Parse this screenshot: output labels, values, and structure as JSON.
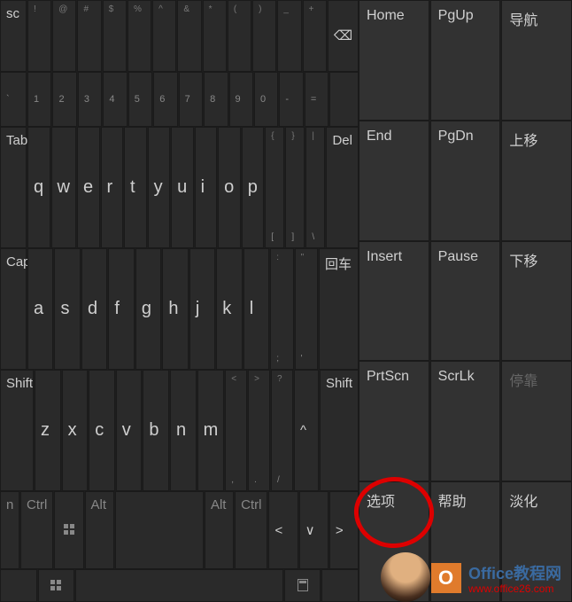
{
  "row0": {
    "esc": "sc",
    "syms": [
      "!",
      "@",
      "#",
      "$",
      "%",
      "^",
      "&",
      "*",
      "(",
      ")",
      "_",
      "+"
    ],
    "backspace": "⌫"
  },
  "row0b": {
    "nums": [
      "`",
      "1",
      "2",
      "3",
      "4",
      "5",
      "6",
      "7",
      "8",
      "9",
      "0",
      "-",
      "="
    ]
  },
  "row1": {
    "tab": "Tab",
    "keys": [
      "q",
      "w",
      "e",
      "r",
      "t",
      "y",
      "u",
      "i",
      "o",
      "p"
    ],
    "brackets": [
      "{",
      "}",
      "|"
    ],
    "del": "Del"
  },
  "row1b": {
    "syms": [
      "[",
      "]",
      "\\"
    ]
  },
  "row2": {
    "caps": "Caps",
    "keys": [
      "a",
      "s",
      "d",
      "f",
      "g",
      "h",
      "j",
      "k",
      "l"
    ],
    "colon": ":",
    "quote": "\"",
    "enter": "回车"
  },
  "row2b": {
    "syms": [
      ";",
      "'"
    ]
  },
  "row3": {
    "shift_l": "Shift",
    "keys": [
      "z",
      "x",
      "c",
      "v",
      "b",
      "n",
      "m"
    ],
    "syms_top": [
      "<",
      ">",
      "?"
    ],
    "caret": "^",
    "shift_r": "Shift"
  },
  "row3b": {
    "syms": [
      ",",
      ".",
      "/"
    ]
  },
  "row4": {
    "fn": "n",
    "ctrl_l": "Ctrl",
    "alt_l": "Alt",
    "alt_r": "Alt",
    "ctrl_r": "Ctrl",
    "arrows": [
      "<",
      "∨",
      ">"
    ]
  },
  "nav": {
    "r0": [
      "Home",
      "PgUp",
      "导航"
    ],
    "r1": [
      "End",
      "PgDn",
      "上移"
    ],
    "r2": [
      "Insert",
      "Pause",
      "下移"
    ],
    "r3": [
      "PrtScn",
      "ScrLk",
      "停靠"
    ],
    "r4": [
      "选项",
      "帮助",
      "淡化"
    ]
  },
  "brand": {
    "title": "Office教程网",
    "url": "www.office26.com"
  }
}
